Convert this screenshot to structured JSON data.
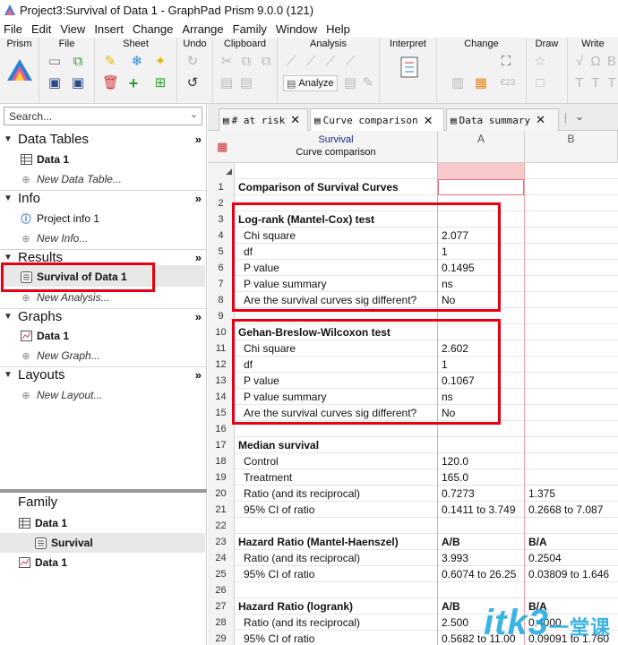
{
  "window": {
    "title": "Project3:Survival of Data 1 - GraphPad Prism 9.0.0 (121)"
  },
  "menu": [
    "File",
    "Edit",
    "View",
    "Insert",
    "Change",
    "Arrange",
    "Family",
    "Window",
    "Help"
  ],
  "ribbon": {
    "groups": [
      "Prism",
      "File",
      "Sheet",
      "Undo",
      "Clipboard",
      "Analysis",
      "Interpret",
      "Change",
      "Draw",
      "Write"
    ],
    "analyze_label": "Analyze"
  },
  "navigator": {
    "search_placeholder": "Search...",
    "sections": {
      "data_tables": {
        "label": "Data Tables",
        "items": [
          "Data 1"
        ],
        "new": "New Data Table..."
      },
      "info": {
        "label": "Info",
        "items": [
          "Project info 1"
        ],
        "new": "New Info..."
      },
      "results": {
        "label": "Results",
        "items": [
          "Survival of Data 1"
        ],
        "new": "New Analysis..."
      },
      "graphs": {
        "label": "Graphs",
        "items": [
          "Data 1"
        ],
        "new": "New Graph..."
      },
      "layouts": {
        "label": "Layouts",
        "new": "New Layout..."
      }
    },
    "more": "»",
    "family": {
      "label": "Family",
      "items": [
        "Data 1",
        "Survival",
        "Data 1"
      ]
    }
  },
  "tabs": [
    {
      "label": "# at risk"
    },
    {
      "label": "Curve comparison"
    },
    {
      "label": "Data summary"
    }
  ],
  "sheet": {
    "title": "Survival",
    "subtitle": "Curve comparison",
    "columns": [
      "A",
      "B"
    ],
    "rows": [
      {
        "n": "1",
        "label": "Comparison of Survival Curves",
        "a": "",
        "b": "",
        "style": "h"
      },
      {
        "n": "2",
        "label": "",
        "a": "",
        "b": "",
        "style": ""
      },
      {
        "n": "3",
        "label": "Log-rank (Mantel-Cox) test",
        "a": "",
        "b": "",
        "style": "h"
      },
      {
        "n": "4",
        "label": "Chi square",
        "a": "2.077",
        "b": "",
        "style": "i"
      },
      {
        "n": "5",
        "label": "df",
        "a": "1",
        "b": "",
        "style": "i"
      },
      {
        "n": "6",
        "label": "P value",
        "a": "0.1495",
        "b": "",
        "style": "i"
      },
      {
        "n": "7",
        "label": "P value summary",
        "a": "ns",
        "b": "",
        "style": "i"
      },
      {
        "n": "8",
        "label": "Are the survival curves sig different?",
        "a": "No",
        "b": "",
        "style": "i"
      },
      {
        "n": "9",
        "label": "",
        "a": "",
        "b": "",
        "style": ""
      },
      {
        "n": "10",
        "label": "Gehan-Breslow-Wilcoxon test",
        "a": "",
        "b": "",
        "style": "h"
      },
      {
        "n": "11",
        "label": "Chi square",
        "a": "2.602",
        "b": "",
        "style": "i"
      },
      {
        "n": "12",
        "label": "df",
        "a": "1",
        "b": "",
        "style": "i"
      },
      {
        "n": "13",
        "label": "P value",
        "a": "0.1067",
        "b": "",
        "style": "i"
      },
      {
        "n": "14",
        "label": "P value summary",
        "a": "ns",
        "b": "",
        "style": "i"
      },
      {
        "n": "15",
        "label": "Are the survival curves sig different?",
        "a": "No",
        "b": "",
        "style": "i"
      },
      {
        "n": "16",
        "label": "",
        "a": "",
        "b": "",
        "style": ""
      },
      {
        "n": "17",
        "label": "Median survival",
        "a": "",
        "b": "",
        "style": "h"
      },
      {
        "n": "18",
        "label": "Control",
        "a": "120.0",
        "b": "",
        "style": "i"
      },
      {
        "n": "19",
        "label": "Treatment",
        "a": "165.0",
        "b": "",
        "style": "i"
      },
      {
        "n": "20",
        "label": "Ratio (and its reciprocal)",
        "a": "0.7273",
        "b": "1.375",
        "style": "i"
      },
      {
        "n": "21",
        "label": "95% CI of ratio",
        "a": "0.1411 to 3.749",
        "b": "0.2668 to 7.087",
        "style": "i"
      },
      {
        "n": "22",
        "label": "",
        "a": "",
        "b": "",
        "style": ""
      },
      {
        "n": "23",
        "label": "Hazard Ratio (Mantel-Haenszel)",
        "a": "A/B",
        "b": "B/A",
        "style": "h",
        "bold_cells": true
      },
      {
        "n": "24",
        "label": "Ratio (and its reciprocal)",
        "a": "3.993",
        "b": "0.2504",
        "style": "i"
      },
      {
        "n": "25",
        "label": "95% CI of ratio",
        "a": "0.6074 to 26.25",
        "b": "0.03809 to 1.646",
        "style": "i"
      },
      {
        "n": "26",
        "label": "",
        "a": "",
        "b": "",
        "style": ""
      },
      {
        "n": "27",
        "label": "Hazard Ratio (logrank)",
        "a": "A/B",
        "b": "B/A",
        "style": "h",
        "bold_cells": true
      },
      {
        "n": "28",
        "label": "Ratio (and its reciprocal)",
        "a": "2.500",
        "b": "0.4000",
        "style": "i"
      },
      {
        "n": "29",
        "label": "95% CI of ratio",
        "a": "0.5682 to 11.00",
        "b": "0.09091 to 1.760",
        "style": "i"
      }
    ]
  },
  "watermark": {
    "text": "itk3",
    "suffix": "一堂课"
  },
  "colors": {
    "highlight": "#e60012",
    "selected_cell": "#f6c9cc",
    "grid_line": "#f2a0a8",
    "watermark": "#1aa6df"
  }
}
